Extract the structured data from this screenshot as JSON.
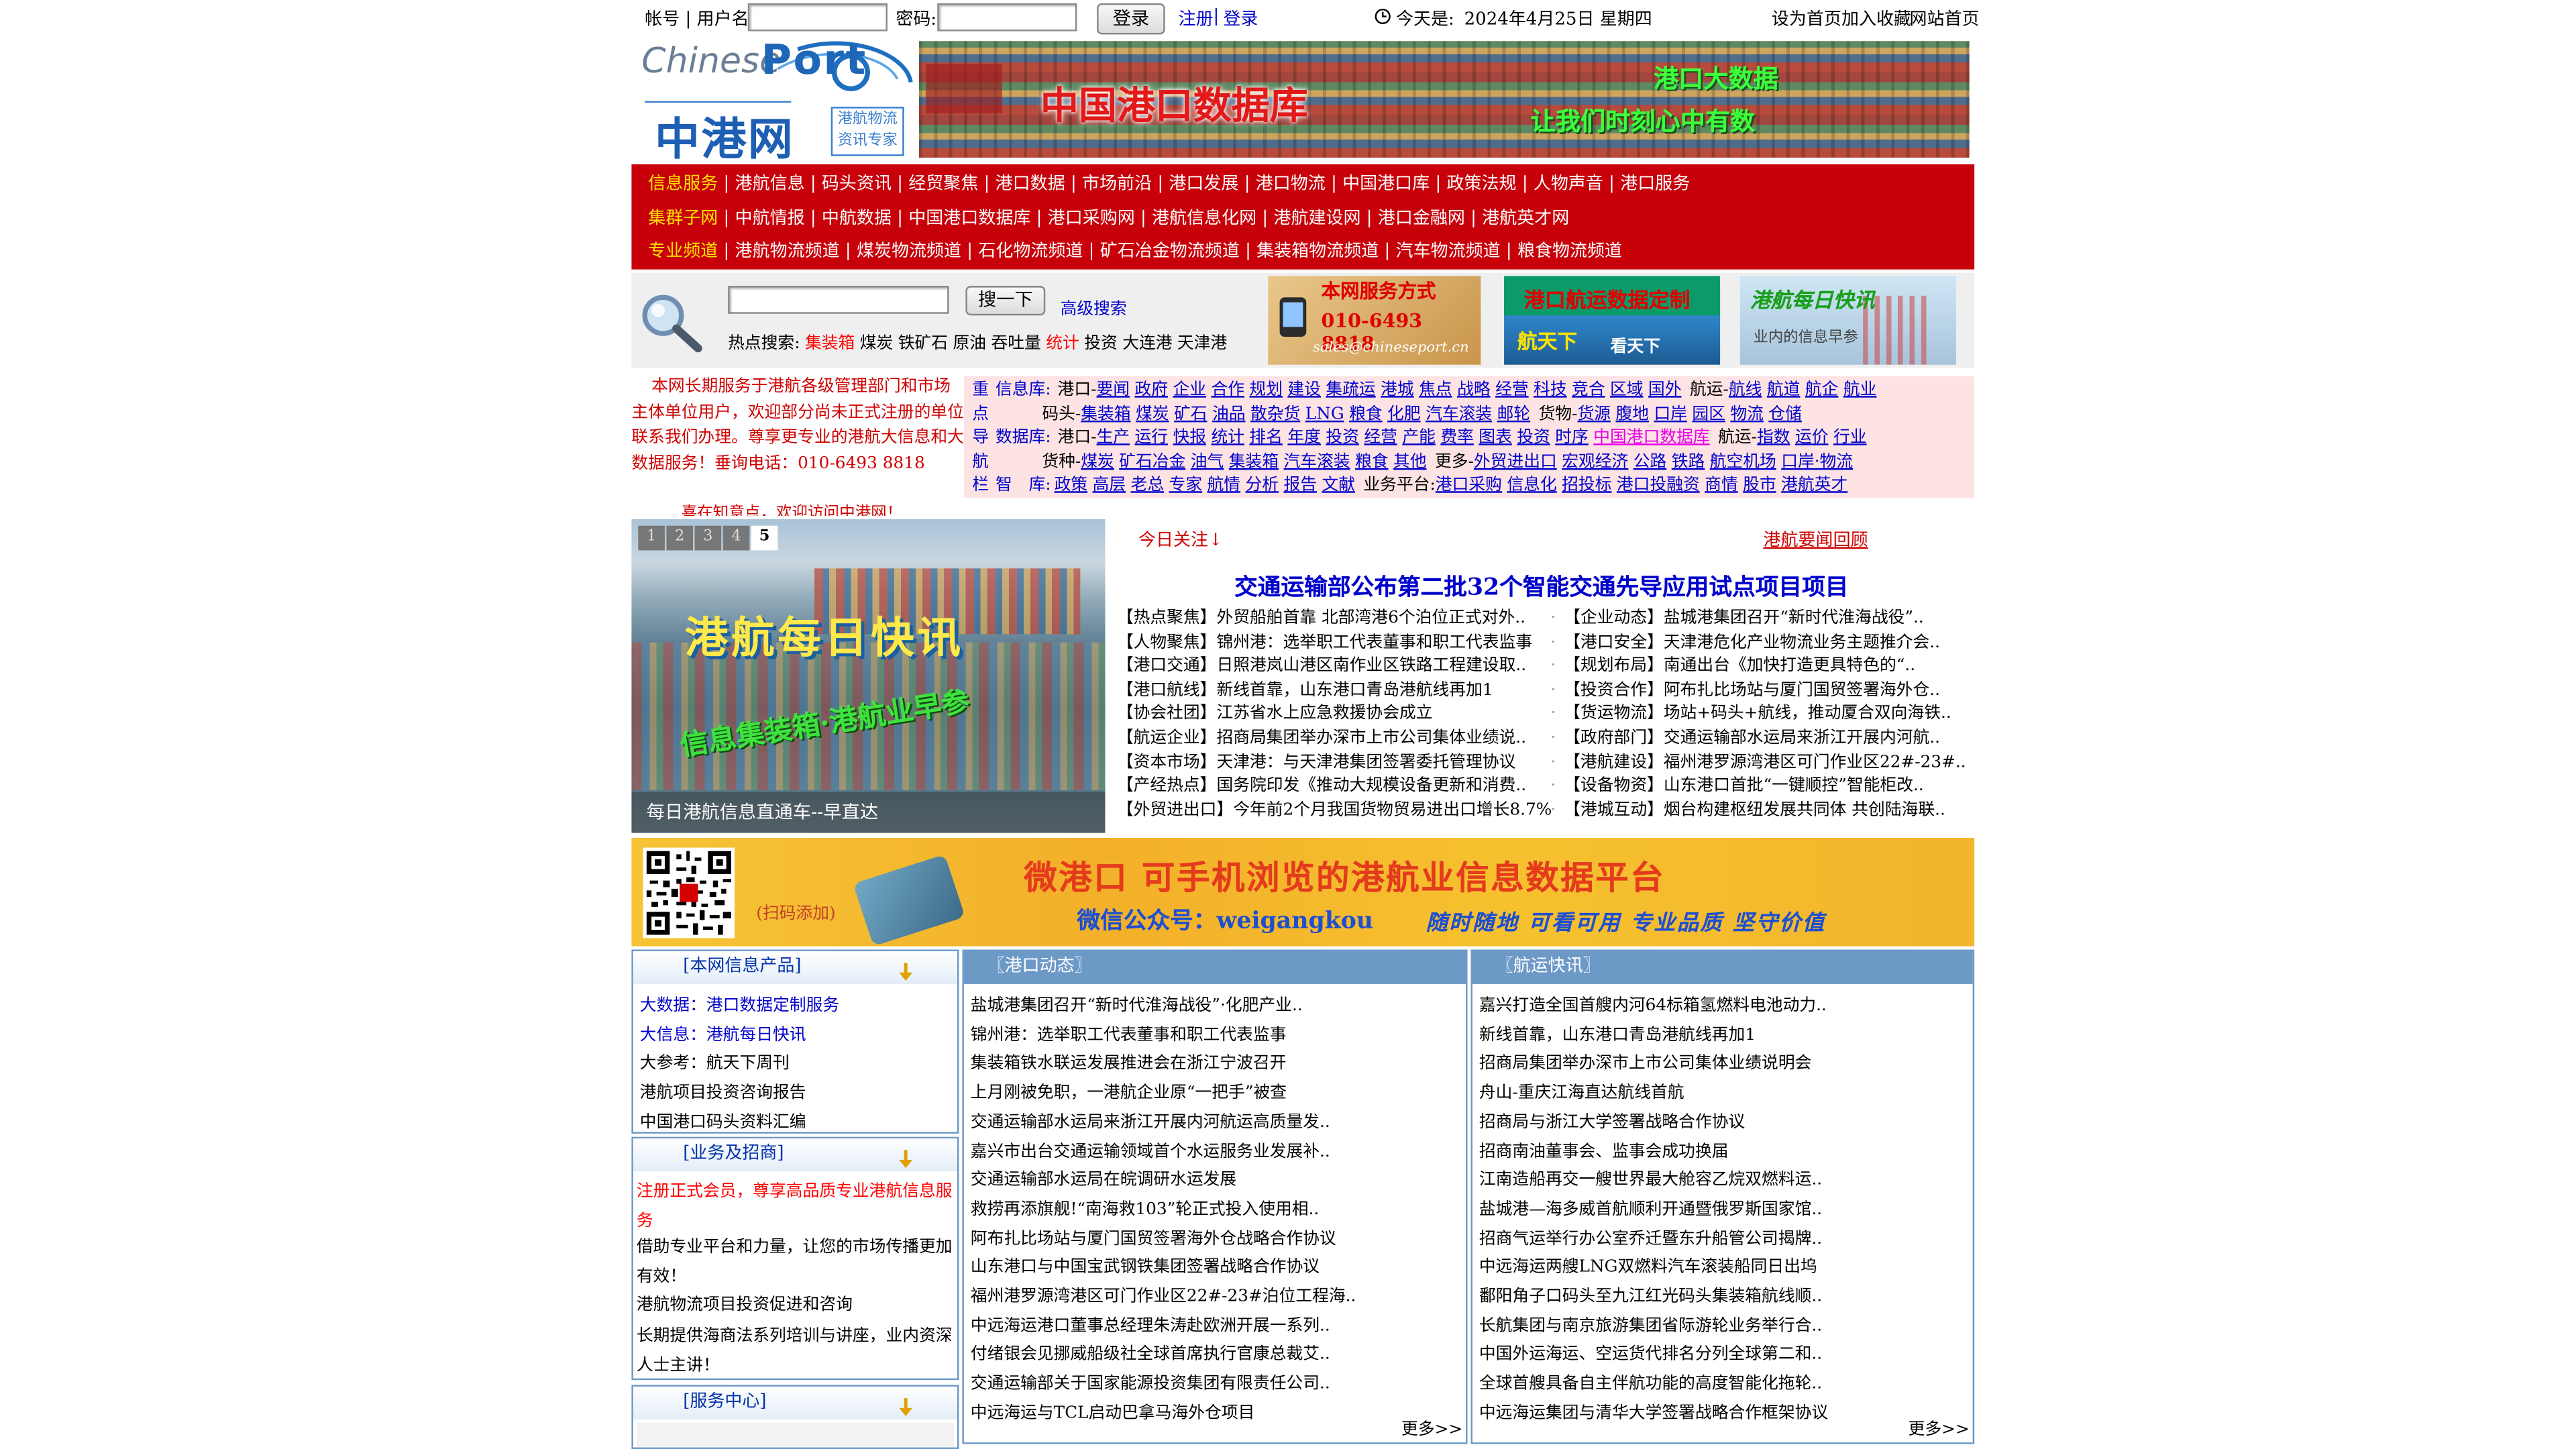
{
  "topbar": {
    "account_label": "帐号 | 用户名:",
    "password_label": "密码:",
    "login_button": "登录",
    "register_link": "注册",
    "sep": "|",
    "login_link": "登录",
    "today_label": "今天是:",
    "date": "2024年4月25日 星期四",
    "set_home": "设为首页",
    "add_fav": "加入收藏",
    "site_home": "网站首页"
  },
  "logo": {
    "chinese": "Chinese",
    "port": "Port",
    "brand": "中港网",
    "slogan": "港航物流资讯专家"
  },
  "banner1": {
    "title": "中国港口数据库",
    "line1": "港口大数据",
    "line2": "让我们时刻心中有数"
  },
  "rednav": [
    {
      "cat": "信息服务",
      "items": [
        "港航信息",
        "码头资讯",
        "经贸聚焦",
        "港口数据",
        "市场前沿",
        "港口发展",
        "港口物流",
        "中国港口库",
        "政策法规",
        "人物声音",
        "港口服务"
      ]
    },
    {
      "cat": "集群子网",
      "items": [
        "中航情报",
        "中航数据",
        "中国港口数据库",
        "港口采购网",
        "港航信息化网",
        "港航建设网",
        "港口金融网",
        "港航英才网"
      ]
    },
    {
      "cat": "专业频道",
      "items": [
        "港航物流频道",
        "煤炭物流频道",
        "石化物流频道",
        "矿石冶金物流频道",
        "集装箱物流频道",
        "汽车物流频道",
        "粮食物流频道"
      ]
    }
  ],
  "search": {
    "button": "搜一下",
    "advanced": "高级搜索",
    "hot_label": "热点搜索:",
    "hot": [
      {
        "t": "集装箱",
        "red": true
      },
      {
        "t": "煤炭",
        "red": false
      },
      {
        "t": "铁矿石",
        "red": false
      },
      {
        "t": "原油",
        "red": false
      },
      {
        "t": "吞吐量",
        "red": false
      },
      {
        "t": "统计",
        "red": true
      },
      {
        "t": "投资",
        "red": false
      },
      {
        "t": "大连港",
        "red": false
      },
      {
        "t": "天津港",
        "red": false
      }
    ]
  },
  "ads": {
    "contact_title": "本网服务方式",
    "contact_phone": "010-6493 8818",
    "contact_email": "sales@chineseport.cn",
    "custom_title": "港口航运数据定制",
    "custom_sub1": "航天下",
    "custom_sub2": "看天下",
    "daily_title": "港航每日快讯",
    "daily_sub": "业内的信息早参"
  },
  "announcement": {
    "text": "本网长期服务于港航各级管理部门和市场主体单位用户，欢迎部分尚未正式注册的单位联系我们办理。尊享更专业的港航大信息和大数据服务！垂询电话：010-6493 8818",
    "scroll": "喜在知意点，欢迎访问中港网！"
  },
  "navbox": {
    "vertical": [
      "重",
      "点",
      "导",
      "航",
      "栏"
    ],
    "lines": [
      {
        "label": "信息库:",
        "segments": [
          {
            "p": "港口-",
            "links": [
              "要闻",
              "政府",
              "企业",
              "合作",
              "规划",
              "建设",
              "集疏运",
              "港城",
              "焦点",
              "战略",
              "经营",
              "科技",
              "竞合",
              "区域",
              "国外"
            ]
          },
          {
            "p": "航运-",
            "links": [
              "航线",
              "航道",
              "航企",
              "航业"
            ]
          }
        ]
      },
      {
        "label": "",
        "segments": [
          {
            "p": "码头-",
            "links": [
              "集装箱",
              "煤炭",
              "矿石",
              "油品",
              "散杂货",
              "LNG",
              "粮食",
              "化肥",
              "汽车滚装",
              "邮轮"
            ]
          },
          {
            "p": "货物-",
            "links": [
              "货源",
              "腹地",
              "口岸",
              "园区",
              "物流",
              "仓储"
            ]
          }
        ]
      },
      {
        "label": "数据库:",
        "segments": [
          {
            "p": "港口-",
            "links": [
              "生产",
              "运行",
              "快报",
              "统计",
              "排名",
              "年度",
              "投资",
              "经营",
              "产能",
              "费率",
              "图表",
              "投资",
              "时序"
            ]
          },
          {
            "p": "",
            "links": [
              "中国港口数据库"
            ]
          },
          {
            "p": "航运-",
            "links": [
              "指数",
              "运价",
              "行业"
            ]
          }
        ]
      },
      {
        "label": "",
        "segments": [
          {
            "p": "货种-",
            "links": [
              "煤炭",
              "矿石冶金",
              "油气",
              "集装箱",
              "汽车滚装",
              "粮食",
              "其他"
            ]
          },
          {
            "p": "更多-",
            "links": [
              "外贸进出口",
              "宏观经济",
              "公路",
              "铁路",
              "航空机场",
              "口岸·物流"
            ]
          }
        ]
      },
      {
        "label": "智　库:",
        "segments": [
          {
            "p": "",
            "links": [
              "政策",
              "高层",
              "老总",
              "专家",
              "航情",
              "分析",
              "报告",
              "文献"
            ]
          },
          {
            "p": "业务平台:",
            "links": [
              "港口采购",
              "信息化",
              "招投标",
              "港口投融资",
              "商情",
              "股市",
              "港航英才"
            ]
          }
        ]
      }
    ]
  },
  "slider": {
    "dots": [
      "1",
      "2",
      "3",
      "4",
      "5"
    ],
    "active": "5",
    "big1": "港航每日快讯",
    "big2": "信息集装箱·港航业早参",
    "caption": "每日港航信息直通车--早直达"
  },
  "news": {
    "today": "今日关注↓",
    "review": "港航要闻回顾",
    "headline": "交通运输部公布第二批32个智能交通先导应用试点项目项目",
    "left": [
      "【热点聚焦】外贸船舶首靠 北部湾港6个泊位正式对外..",
      "【人物聚焦】锦州港：选举职工代表董事和职工代表监事",
      "【港口交通】日照港岚山港区南作业区铁路工程建设取..",
      "【港口航线】新线首靠，山东港口青岛港航线再加1",
      "【协会社团】江苏省水上应急救援协会成立",
      "【航运企业】招商局集团举办深市上市公司集体业绩说..",
      "【资本市场】天津港：与天津港集团签署委托管理协议",
      "【产经热点】国务院印发《推动大规模设备更新和消费..",
      "【外贸进出口】今年前2个月我国货物贸易进出口增长8.7%"
    ],
    "right": [
      "【企业动态】盐城港集团召开“新时代淮海战役”..",
      "【港口安全】天津港危化产业物流业务主题推介会..",
      "【规划布局】南通出台《加快打造更具特色的“..",
      "【投资合作】阿布扎比场站与厦门国贸签署海外仓..",
      "【货运物流】场站+码头+航线，推动厦合双向海铁..",
      "【政府部门】交通运输部水运局来浙江开展内河航..",
      "【港航建设】福州港罗源湾港区可门作业区22#-23#..",
      "【设备物资】山东港口首批“一键顺控”智能柜改..",
      "【港城互动】烟台构建枢纽发展共同体 共创陆海联.."
    ]
  },
  "banner2": {
    "scan": "(扫码添加)",
    "title": "微港口 可手机浏览的港航业信息数据平台",
    "account": "微信公众号：weigangkou",
    "slogan": "随时随地 可看可用 专业品质 坚守价值"
  },
  "box1": {
    "title": "[本网信息产品]",
    "items": [
      {
        "t": "大数据：港口数据定制服务",
        "blue": true
      },
      {
        "t": "大信息：港航每日快讯",
        "blue": true
      },
      {
        "t": "大参考：航天下周刊",
        "blue": false
      },
      {
        "t": "港航项目投资咨询报告",
        "blue": false
      },
      {
        "t": "中国港口码头资料汇编",
        "blue": false
      }
    ]
  },
  "box2": {
    "title": "[业务及招商]",
    "items": [
      {
        "t": "注册正式会员，尊享高品质专业港航信息服务",
        "red": true
      },
      {
        "t": "借助专业平台和力量，让您的市场传播更加有效！",
        "red": false
      },
      {
        "t": "港航物流项目投资促进和咨询",
        "red": false
      },
      {
        "t": "长期提供海商法系列培训与讲座，业内资深人士主讲！",
        "red": false
      }
    ]
  },
  "box3": {
    "title": "[服务中心]"
  },
  "port_news": {
    "title": "〖港口动态〗",
    "items": [
      "盐城港集团召开“新时代淮海战役”·化肥产业..",
      "锦州港：选举职工代表董事和职工代表监事",
      "集装箱铁水联运发展推进会在浙江宁波召开",
      "上月刚被免职，一港航企业原“一把手”被查",
      "交通运输部水运局来浙江开展内河航运高质量发..",
      "嘉兴市出台交通运输领域首个水运服务业发展补..",
      "交通运输部水运局在皖调研水运发展",
      "救捞再添旗舰!“南海救103”轮正式投入使用相..",
      "阿布扎比场站与厦门国贸签署海外仓战略合作协议",
      "山东港口与中国宝武钢铁集团签署战略合作协议",
      "福州港罗源湾港区可门作业区22#-23#泊位工程海..",
      "中远海运港口董事总经理朱涛赴欧洲开展一系列..",
      "付绪银会见挪威船级社全球首席执行官康总裁艾..",
      "交通运输部关于国家能源投资集团有限责任公司..",
      "中远海运与TCL启动巴拿马海外仓项目"
    ],
    "more": "更多>>"
  },
  "shipping_news": {
    "title": "〖航运快讯〗",
    "items": [
      "嘉兴打造全国首艘内河64标箱氢燃料电池动力..",
      "新线首靠，山东港口青岛港航线再加1",
      "招商局集团举办深市上市公司集体业绩说明会",
      "舟山-重庆江海直达航线首航",
      "招商局与浙江大学签署战略合作协议",
      "招商南油董事会、监事会成功换届",
      "江南造船再交一艘世界最大舱容乙烷双燃料运..",
      "盐城港—海多威首航顺利开通暨俄罗斯国家馆..",
      "招商气运举行办公室乔迁暨东升船管公司揭牌..",
      "中远海运两艘LNG双燃料汽车滚装船同日出坞",
      "鄱阳角子口码头至九江红光码头集装箱航线顺..",
      "长航集团与南京旅游集团省际游轮业务举行合..",
      "中国外运海运、空运货代排名分列全球第二和..",
      "全球首艘具备自主伴航功能的高度智能化拖轮..",
      "中远海运集团与清华大学签署战略合作框架协议"
    ],
    "more": "更多>>"
  },
  "colors": {
    "red_nav": "#c8000a",
    "nav_yellow": "#ffe400",
    "link_blue": "#0000cc",
    "box_border": "#6d99c7",
    "banner_orange": "#f5b82e"
  }
}
